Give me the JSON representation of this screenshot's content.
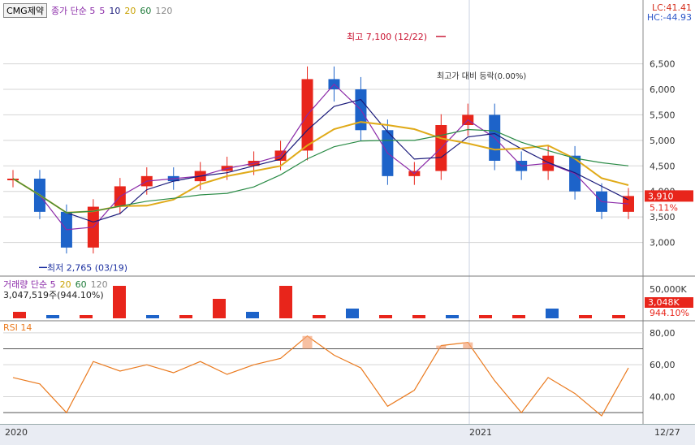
{
  "header": {
    "stock_name": "CMG제약",
    "price_label": "종가 단순 5",
    "ma_labels": [
      "5",
      "10",
      "20",
      "60",
      "120"
    ],
    "lc": "LC:41.41",
    "hc": "HC:-44.93"
  },
  "volume": {
    "label": "거래량 단순 5",
    "ma_labels": [
      "20",
      "60",
      "120"
    ],
    "current_text": "3,047,519주(944.10%)"
  },
  "rsi": {
    "label": "RSI 14"
  },
  "axis": {
    "year_labels": [
      "2020",
      "2021"
    ],
    "end_label": "12/27"
  },
  "colors": {
    "up": "#e8251b",
    "down": "#1d63c9",
    "ma5": "#8b2aa8",
    "ma10": "#1a1a7a",
    "ma20": "#e0aa18",
    "ma60": "#2a8b46",
    "ma120": "#9a9a9a",
    "rsi": "#ea7a1e",
    "grid": "#d5d5d5"
  },
  "chart_data": [
    {
      "type": "line",
      "title": "",
      "x": [
        "2020-01",
        "2020-02",
        "2020-03",
        "2020-04",
        "2020-05",
        "2020-06",
        "2020-07",
        "2020-08",
        "2020-09",
        "2020-10",
        "2020-11",
        "2020-12",
        "2021-01",
        "2021-02",
        "2021-03",
        "2021-04",
        "2021-05",
        "2021-06",
        "2021-07",
        "2021-08",
        "2021-09",
        "2021-10",
        "2021-11",
        "2021-12"
      ],
      "series": [
        {
          "name": "종가",
          "values": [
            4250,
            3600,
            2900,
            3700,
            4100,
            4300,
            4200,
            4400,
            4500,
            4600,
            4800,
            6200,
            6000,
            5200,
            4300,
            4400,
            5300,
            5500,
            4600,
            4400,
            4700,
            4000,
            3600,
            3910
          ]
        }
      ],
      "ylim": [
        2500,
        7400
      ],
      "yticks": [
        "3,000",
        "3,500",
        "4,000",
        "4,500",
        "5,000",
        "5,500",
        "6,000",
        "6,500"
      ],
      "grid": true,
      "annotations": [
        {
          "text": "최고 7,100 (12/22)",
          "value": 7100
        },
        {
          "text": "최저 2,765 (03/19)",
          "value": 2765
        },
        {
          "text": "최고가 대비 등락(0.00%)",
          "value": 6300
        }
      ],
      "last_price_label": "3,910",
      "last_change_label": "5.11%"
    },
    {
      "type": "bar",
      "title": "거래량",
      "values": [
        20,
        10,
        10,
        100,
        10,
        10,
        60,
        20,
        100,
        10,
        30,
        10,
        10,
        10,
        10,
        10,
        30,
        10,
        10
      ],
      "ylim": [
        0,
        100
      ],
      "yticks": [
        "50,000K"
      ],
      "last_label": "3,048K",
      "last_pct_label": "944.10%"
    },
    {
      "type": "line",
      "title": "RSI 14",
      "x": [
        "2020-01",
        "2020-02",
        "2020-03",
        "2020-04",
        "2020-05",
        "2020-06",
        "2020-07",
        "2020-08",
        "2020-09",
        "2020-10",
        "2020-11",
        "2020-12",
        "2021-01",
        "2021-02",
        "2021-03",
        "2021-04",
        "2021-05",
        "2021-06",
        "2021-07",
        "2021-08",
        "2021-09",
        "2021-10",
        "2021-11",
        "2021-12"
      ],
      "series": [
        {
          "name": "RSI 14",
          "values": [
            52,
            48,
            30,
            62,
            56,
            60,
            55,
            62,
            54,
            60,
            64,
            78,
            66,
            58,
            34,
            44,
            72,
            74,
            50,
            30,
            52,
            42,
            28,
            58
          ]
        }
      ],
      "ylim": [
        25,
        85
      ],
      "yticks": [
        "40,00",
        "60,00",
        "80,00"
      ],
      "reference_lines": [
        30,
        70
      ],
      "grid": true
    }
  ]
}
